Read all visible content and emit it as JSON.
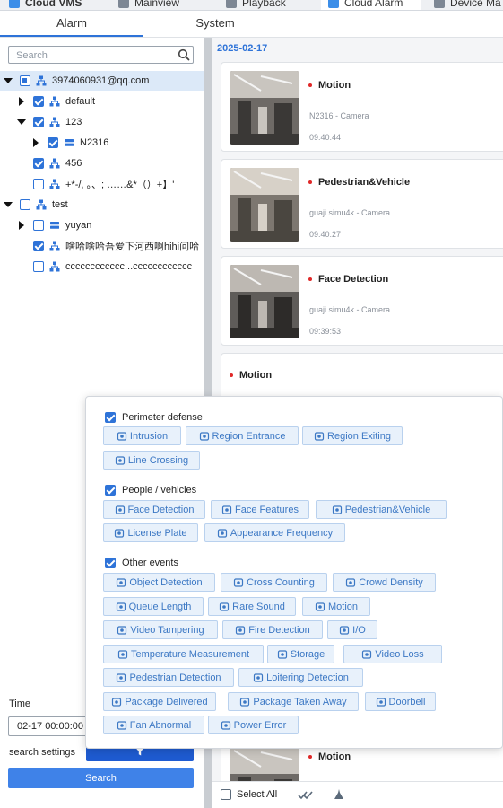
{
  "topbar": {
    "tabs": [
      {
        "label": "Cloud VMS",
        "icon": "cloud-vms-logo-icon"
      },
      {
        "label": "Mainview",
        "icon": "mainview-icon"
      },
      {
        "label": "Playback",
        "icon": "playback-icon"
      },
      {
        "label": "Cloud Alarm",
        "icon": "cloud-alarm-icon",
        "active": true
      },
      {
        "label": "Device Ma",
        "icon": "device-management-icon"
      }
    ]
  },
  "subtabs": [
    {
      "label": "Alarm",
      "active": true
    },
    {
      "label": "System",
      "active": false
    }
  ],
  "search": {
    "placeholder": "Search"
  },
  "tree": [
    {
      "label": "3974060931@qq.com",
      "level": 0,
      "caret": "down",
      "check": "partial",
      "icon": "org-icon",
      "selected": true
    },
    {
      "label": "default",
      "level": 1,
      "caret": "right",
      "check": "checked",
      "icon": "org-icon"
    },
    {
      "label": "123",
      "level": 1,
      "caret": "down",
      "check": "checked",
      "icon": "org-icon"
    },
    {
      "label": "N2316",
      "level": 2,
      "caret": "right",
      "check": "checked",
      "icon": "nvr-icon"
    },
    {
      "label": "456",
      "level": 1,
      "caret": "none",
      "check": "checked",
      "icon": "org-icon"
    },
    {
      "label": "+*-/, 。、; ……&*（）+】'",
      "level": 1,
      "caret": "none",
      "check": "unchecked",
      "icon": "org-icon"
    },
    {
      "label": "test",
      "level": 0,
      "caret": "down",
      "check": "unchecked",
      "icon": "org-icon"
    },
    {
      "label": "yuyan",
      "level": 1,
      "caret": "right",
      "check": "unchecked",
      "icon": "nvr-icon"
    },
    {
      "label": "啥哈啥哈吾爱下河西啊hihi问哈",
      "level": 1,
      "caret": "none",
      "check": "checked",
      "icon": "org-icon"
    },
    {
      "label": "cccccccccccc...cccccccccccc",
      "level": 1,
      "caret": "none",
      "check": "unchecked",
      "icon": "org-icon"
    }
  ],
  "time": {
    "label": "Time",
    "value": "02-17 00:00:00"
  },
  "search_settings": {
    "label": "search settings",
    "icon": "filter-icon"
  },
  "search_button": {
    "label": "Search"
  },
  "alarm_list": {
    "date": "2025-02-17",
    "items": [
      {
        "title": "Motion",
        "source": "N2316 - Camera",
        "time": "09:40:44"
      },
      {
        "title": "Pedestrian&Vehicle",
        "source": "guaji simu4k - Camera",
        "time": "09:40:27"
      },
      {
        "title": "Face Detection",
        "source": "guaji simu4k - Camera",
        "time": "09:39:53"
      },
      {
        "title": "Motion",
        "source": "",
        "time": ""
      },
      {
        "title": "Motion",
        "source": "",
        "time": ""
      }
    ]
  },
  "bottom_bar": {
    "select_all": "Select All",
    "icons": [
      "mark-read-icon",
      "clear-icon"
    ]
  },
  "filter_popup": {
    "groups": [
      {
        "label": "Perimeter defense",
        "checked": true,
        "chips": [
          {
            "label": "Intrusion",
            "icon": "intrusion-icon"
          },
          {
            "label": "Region Entrance",
            "icon": "region-entrance-icon"
          },
          {
            "label": "Region Exiting",
            "icon": "region-exiting-icon"
          },
          {
            "label": "Line Crossing",
            "icon": "line-crossing-icon"
          }
        ]
      },
      {
        "label": "People / vehicles",
        "checked": true,
        "chips": [
          {
            "label": "Face Detection",
            "icon": "face-detection-icon"
          },
          {
            "label": "Face Features",
            "icon": "face-features-icon"
          },
          {
            "label": "Pedestrian&Vehicle",
            "icon": "pedestrian-vehicle-icon"
          },
          {
            "label": "License Plate",
            "icon": "license-plate-icon"
          },
          {
            "label": "Appearance Frequency",
            "icon": "appearance-frequency-icon"
          }
        ]
      },
      {
        "label": "Other events",
        "checked": true,
        "chips": [
          {
            "label": "Object Detection",
            "icon": "object-detection-icon"
          },
          {
            "label": "Cross Counting",
            "icon": "cross-counting-icon"
          },
          {
            "label": "Crowd Density",
            "icon": "crowd-density-icon"
          },
          {
            "label": "Queue Length",
            "icon": "queue-length-icon"
          },
          {
            "label": "Rare Sound",
            "icon": "rare-sound-icon"
          },
          {
            "label": "Motion",
            "icon": "motion-icon"
          },
          {
            "label": "Video Tampering",
            "icon": "video-tampering-icon"
          },
          {
            "label": "Fire Detection",
            "icon": "fire-detection-icon"
          },
          {
            "label": "I/O",
            "icon": "io-icon"
          },
          {
            "label": "Temperature Measurement",
            "icon": "temperature-icon"
          },
          {
            "label": "Storage",
            "icon": "storage-icon"
          },
          {
            "label": "Video Loss",
            "icon": "video-loss-icon"
          },
          {
            "label": "Pedestrian Detection",
            "icon": "pedestrian-detection-icon"
          },
          {
            "label": "Loitering Detection",
            "icon": "loitering-detection-icon"
          },
          {
            "label": "Package Delivered",
            "icon": "package-delivered-icon"
          },
          {
            "label": "Package Taken Away",
            "icon": "package-taken-icon"
          },
          {
            "label": "Doorbell",
            "icon": "doorbell-icon"
          },
          {
            "label": "Fan Abnormal",
            "icon": "fan-abnormal-icon"
          },
          {
            "label": "Power Error",
            "icon": "power-error-icon"
          }
        ]
      }
    ]
  },
  "colors": {
    "accent": "#2e73d8",
    "chip_bg": "#e8f1fb",
    "chip_text": "#3c78c4",
    "alert_dot": "#e02828"
  }
}
